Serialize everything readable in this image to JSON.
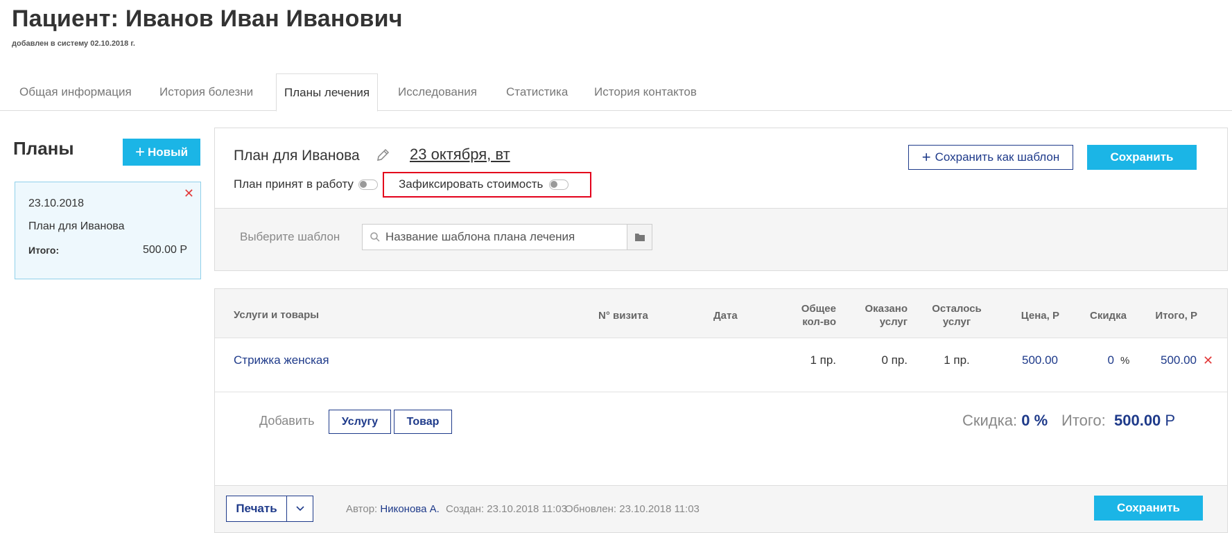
{
  "header": {
    "title": "Пациент: Иванов Иван Иванович",
    "added": "добавлен в систему 02.10.2018 г."
  },
  "tabs": [
    {
      "label": "Общая информация",
      "active": false
    },
    {
      "label": "История болезни",
      "active": false
    },
    {
      "label": "Планы лечения",
      "active": true
    },
    {
      "label": "Исследования",
      "active": false
    },
    {
      "label": "Статистика",
      "active": false
    },
    {
      "label": "История контактов",
      "active": false
    }
  ],
  "sidebar": {
    "title": "Планы",
    "new_button": "Новый",
    "plans": [
      {
        "date": "23.10.2018",
        "name": "План для Иванова",
        "total_label": "Итого:",
        "total_value": "500.00 Р"
      }
    ]
  },
  "plan": {
    "name": "План для Иванова",
    "date": "23 октября, вт",
    "accepted_label": "План принят в работу",
    "fix_cost_label": "Зафиксировать стоимость",
    "save_template_button": "Сохранить как шаблон",
    "save_button": "Сохранить"
  },
  "template": {
    "label": "Выберите шаблон",
    "placeholder": "Название шаблона плана лечения"
  },
  "table": {
    "headers": {
      "service": "Услуги и товары",
      "visit": "N° визита",
      "date": "Дата",
      "total_qty_1": "Общее",
      "total_qty_2": "кол-во",
      "done_1": "Оказано",
      "done_2": "услуг",
      "left_1": "Осталось",
      "left_2": "услуг",
      "price": "Цена, Р",
      "discount": "Скидка",
      "total": "Итого, Р"
    },
    "rows": [
      {
        "service": "Стрижка женская",
        "total_qty": "1 пр.",
        "done": "0 пр.",
        "left": "1 пр.",
        "price": "500.00",
        "discount": "0",
        "discount_unit": "%",
        "total": "500.00"
      }
    ]
  },
  "add": {
    "label": "Добавить",
    "service_button": "Услугу",
    "product_button": "Товар"
  },
  "summary": {
    "discount_label": "Скидка:",
    "discount_value": "0 %",
    "total_label": "Итого:",
    "total_value": "500.00",
    "currency": "Р"
  },
  "footer": {
    "print_button": "Печать",
    "author_label": "Автор:",
    "author": "Никонова А.",
    "created": "Создан: 23.10.2018 11:03",
    "updated": "Обновлен: 23.10.2018 11:03",
    "save_button": "Сохранить"
  },
  "colors": {
    "accent": "#1bb5e6",
    "link": "#1e3a8a",
    "danger": "#e23b3b",
    "highlight": "#e3001b"
  }
}
